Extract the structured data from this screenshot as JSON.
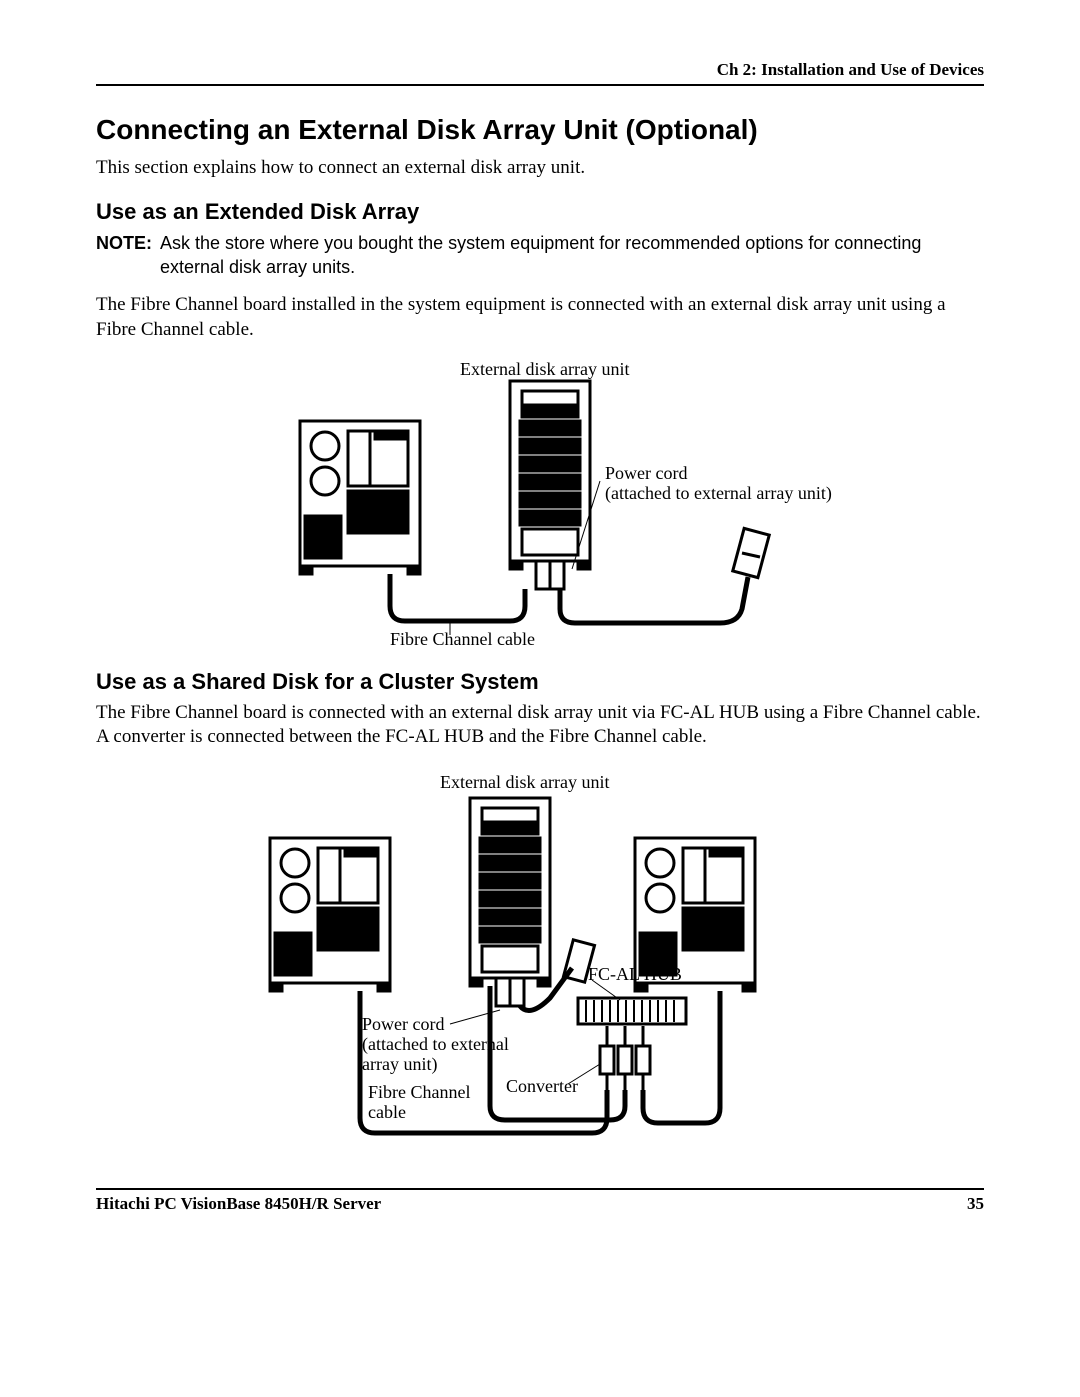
{
  "header": {
    "chapter": "Ch 2: Installation and Use of Devices"
  },
  "section": {
    "title": "Connecting an External Disk Array Unit (Optional)",
    "intro": "This section explains how to connect an external disk array unit."
  },
  "sub1": {
    "title": "Use as an Extended Disk Array",
    "note_label": "NOTE:",
    "note_text": "Ask the store where you bought the system equipment for recommended options for connecting external disk array units.",
    "body": "The Fibre Channel board installed in the system equipment is connected with an external disk array unit using a Fibre Channel cable."
  },
  "sub2": {
    "title": "Use as a Shared Disk for a Cluster System",
    "body": "The Fibre Channel board is connected with an external disk array unit via FC-AL HUB using a Fibre Channel cable. A converter is connected between the FC-AL HUB and the Fibre Channel cable."
  },
  "diagram1": {
    "ext_unit": "External disk array unit",
    "power_cord": "Power cord",
    "power_cord2": "(attached to external array unit)",
    "fc_cable": "Fibre Channel cable"
  },
  "diagram2": {
    "ext_unit": "External disk array unit",
    "power_cord1": "Power cord",
    "power_cord2": "(attached to external",
    "power_cord3": "array unit)",
    "fc_cable1": "Fibre Channel",
    "fc_cable2": "cable",
    "converter": "Converter",
    "hub": "FC-AL HUB"
  },
  "footer": {
    "product": "Hitachi PC VisionBase 8450H/R Server",
    "page": "35"
  }
}
